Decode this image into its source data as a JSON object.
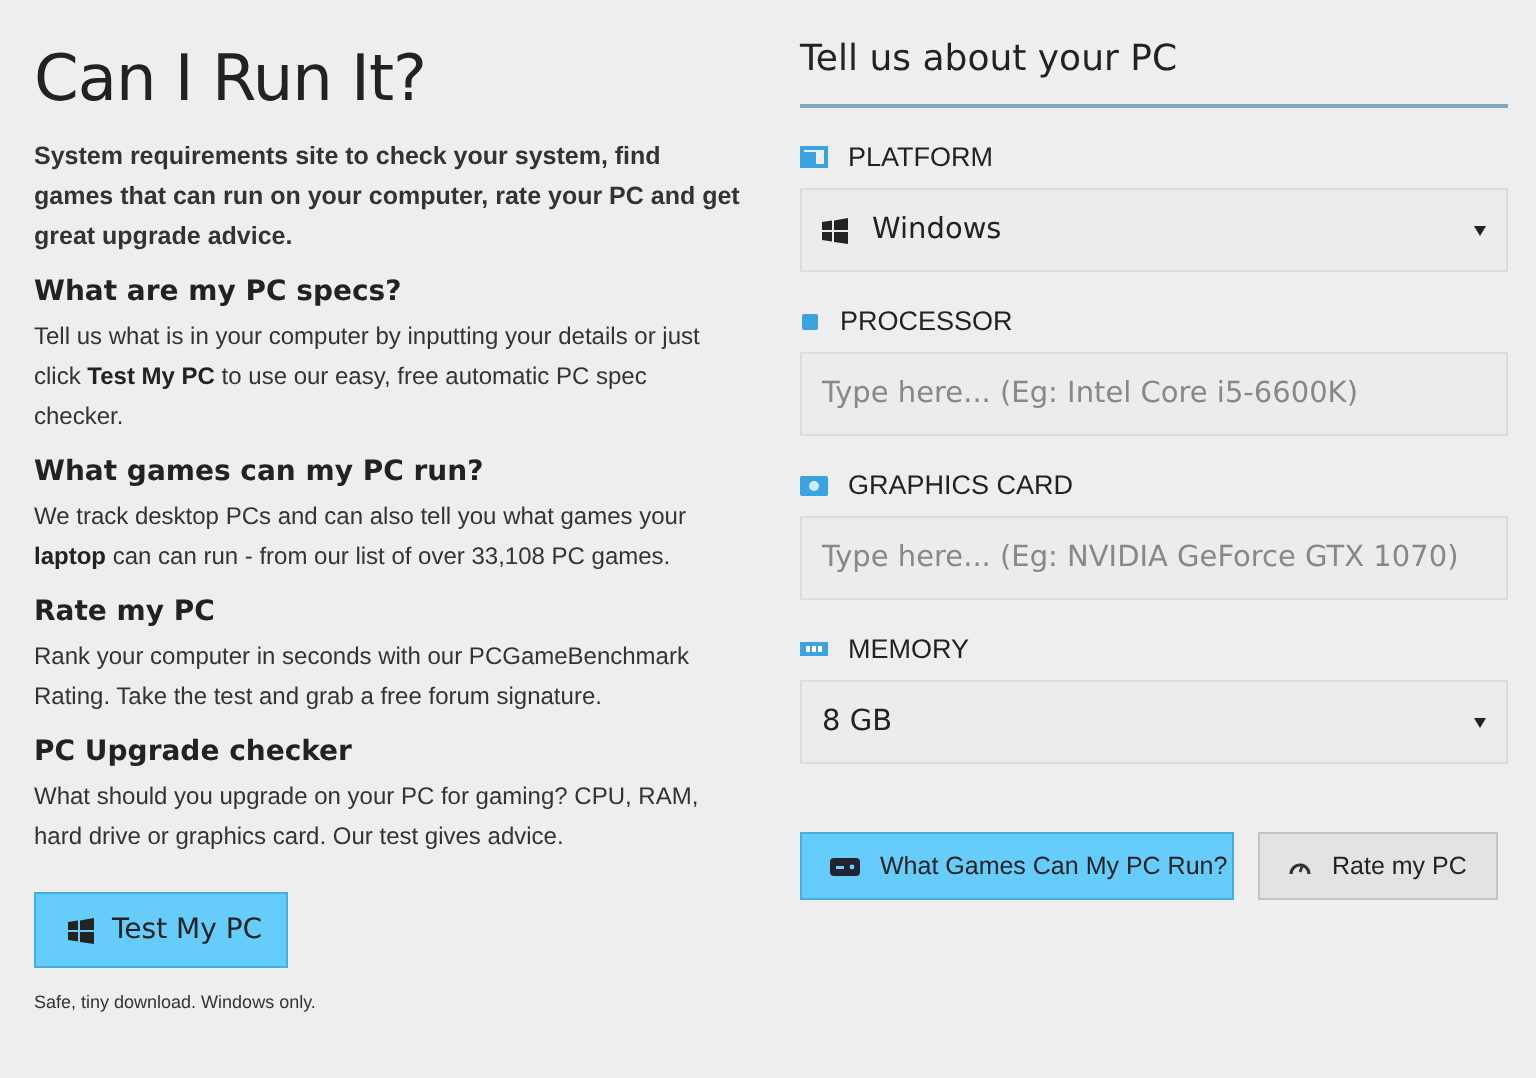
{
  "title": "Can I Run It?",
  "intro": "System requirements site to check your system, find games that can run on your computer, rate your PC and get great upgrade advice.",
  "sections": [
    {
      "heading": "What are my PC specs?",
      "text": "Tell us what is in your computer by inputting your details or just click **Test My PC** to use our easy, free automatic PC spec checker."
    },
    {
      "heading": "What games can my PC run?",
      "text": "We track desktop PCs and can also tell you what games your **laptop** can can run - from our list of over 33,108 PC games."
    },
    {
      "heading": "Rate my PC",
      "text": "Rank your computer in seconds with our PCGameBenchmark Rating. Take the test and grab a free forum signature."
    },
    {
      "heading": "PC Upgrade checker",
      "text": "What should you upgrade on your PC for gaming? CPU, RAM, hard drive or graphics card. Our test gives advice."
    }
  ],
  "test_button": "Test My PC",
  "note": "Safe, tiny download. Windows only.",
  "form": {
    "heading": "Tell us about your PC",
    "fields": [
      {
        "label": "PLATFORM",
        "kind": "select",
        "value": "Windows"
      },
      {
        "label": "PROCESSOR",
        "kind": "text",
        "placeholder": "Type here... (Eg: Intel Core i5-6600K)"
      },
      {
        "label": "GRAPHICS CARD",
        "kind": "text",
        "placeholder": "Type here... (Eg: NVIDIA GeForce GTX 1070)"
      },
      {
        "label": "MEMORY",
        "kind": "select",
        "value": "8 GB"
      }
    ],
    "buttons": [
      {
        "label": "What Games Can My PC Run?",
        "kind": "primary"
      },
      {
        "label": "Rate my PC",
        "kind": "secondary"
      }
    ]
  }
}
